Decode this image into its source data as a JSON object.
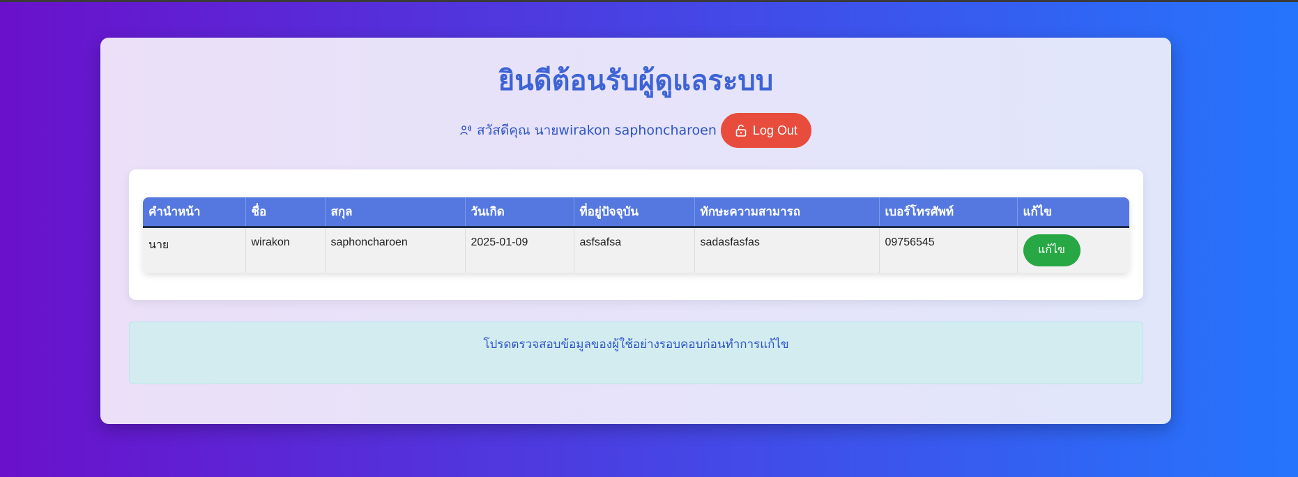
{
  "header": {
    "title": "ยินดีต้อนรับผู้ดูแลระบบ",
    "greeting": "สวัสดีคุณ นายwirakon saphoncharoen",
    "logout_label": "Log Out"
  },
  "table": {
    "columns": [
      "คำนำหน้า",
      "ชื่อ",
      "สกุล",
      "วันเกิด",
      "ที่อยู่ปัจจุบัน",
      "ทักษะความสามารถ",
      "เบอร์โทรศัพท์",
      "แก้ไข"
    ],
    "rows": [
      {
        "prefix": "นาย",
        "first_name": "wirakon",
        "last_name": "saphoncharoen",
        "birthdate": "2025-01-09",
        "address": "asfsafsa",
        "skills": "sadasfasfas",
        "phone": "09756545",
        "edit_label": "แก้ไข"
      }
    ]
  },
  "notice": {
    "text": "โปรดตรวจสอบข้อมูลของผู้ใช้อย่างรอบคอบก่อนทำการแก้ไข"
  },
  "colors": {
    "accent": "#3d63d6",
    "table_header": "#5478e0",
    "logout": "#e74c3c",
    "edit": "#28a745",
    "notice_bg": "#d2ecf0"
  },
  "icons": {
    "greeting": "user-voice-icon",
    "logout": "unlock-icon"
  }
}
